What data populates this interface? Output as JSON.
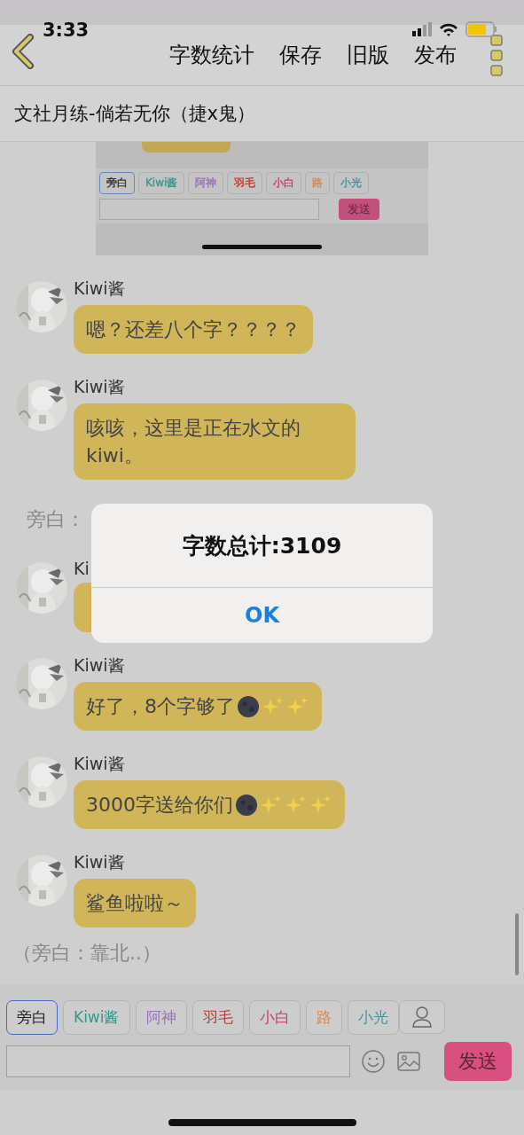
{
  "status_bar": {
    "time": "3:33"
  },
  "nav": {
    "actions": [
      "字数统计",
      "保存",
      "旧版",
      "发布"
    ]
  },
  "title": "文社月练-倘若无你（捷x鬼）",
  "embedded_screenshot": {
    "chips": [
      {
        "label": "旁白",
        "color": "#333333",
        "selected": true
      },
      {
        "label": "Kiwi酱",
        "color": "#3a9a8f",
        "selected": false
      },
      {
        "label": "阿神",
        "color": "#9b6fc0",
        "selected": false
      },
      {
        "label": "羽毛",
        "color": "#c0392b",
        "selected": false
      },
      {
        "label": "小白",
        "color": "#c8406a",
        "selected": false
      },
      {
        "label": "路",
        "color": "#d8884a",
        "selected": false
      },
      {
        "label": "小光",
        "color": "#4a90a0",
        "selected": false
      }
    ],
    "send": "发送"
  },
  "messages": [
    {
      "kind": "chat",
      "name": "Kiwi酱",
      "text": "嗯？还差八个字？？？？"
    },
    {
      "kind": "chat",
      "name": "Kiwi酱",
      "text": "咳咳，这里是正在水文的kiwi。"
    },
    {
      "kind": "narration",
      "text": "旁白："
    },
    {
      "kind": "covered",
      "name": "Ki"
    },
    {
      "kind": "chat",
      "name": "Kiwi酱",
      "text": "好了，8个字够了",
      "emoji": [
        {
          "kind": "moon"
        },
        {
          "kind": "sparkles"
        },
        {
          "kind": "sparkles"
        }
      ]
    },
    {
      "kind": "chat",
      "name": "Kiwi酱",
      "text": "3000字送给你们",
      "emoji": [
        {
          "kind": "moon"
        },
        {
          "kind": "sparkles"
        },
        {
          "kind": "sparkles"
        },
        {
          "kind": "sparkles"
        }
      ]
    },
    {
      "kind": "chat",
      "name": "Kiwi酱",
      "text": "鲨鱼啦啦～"
    },
    {
      "kind": "narration",
      "text": "（旁白：靠北..）"
    }
  ],
  "toolbar": {
    "chips": [
      {
        "label": "旁白",
        "color": "#222222",
        "selected": true
      },
      {
        "label": "Kiwi酱",
        "color": "#2f9a8a",
        "selected": false
      },
      {
        "label": "阿神",
        "color": "#9b6fc0",
        "selected": false
      },
      {
        "label": "羽毛",
        "color": "#c0392b",
        "selected": false
      },
      {
        "label": "小白",
        "color": "#c8406a",
        "selected": false
      },
      {
        "label": "路",
        "color": "#d8884a",
        "selected": false
      },
      {
        "label": "小光",
        "color": "#4a90a0",
        "selected": false
      }
    ],
    "send": "发送"
  },
  "alert": {
    "title": "字数总计:3109",
    "button": "OK"
  }
}
